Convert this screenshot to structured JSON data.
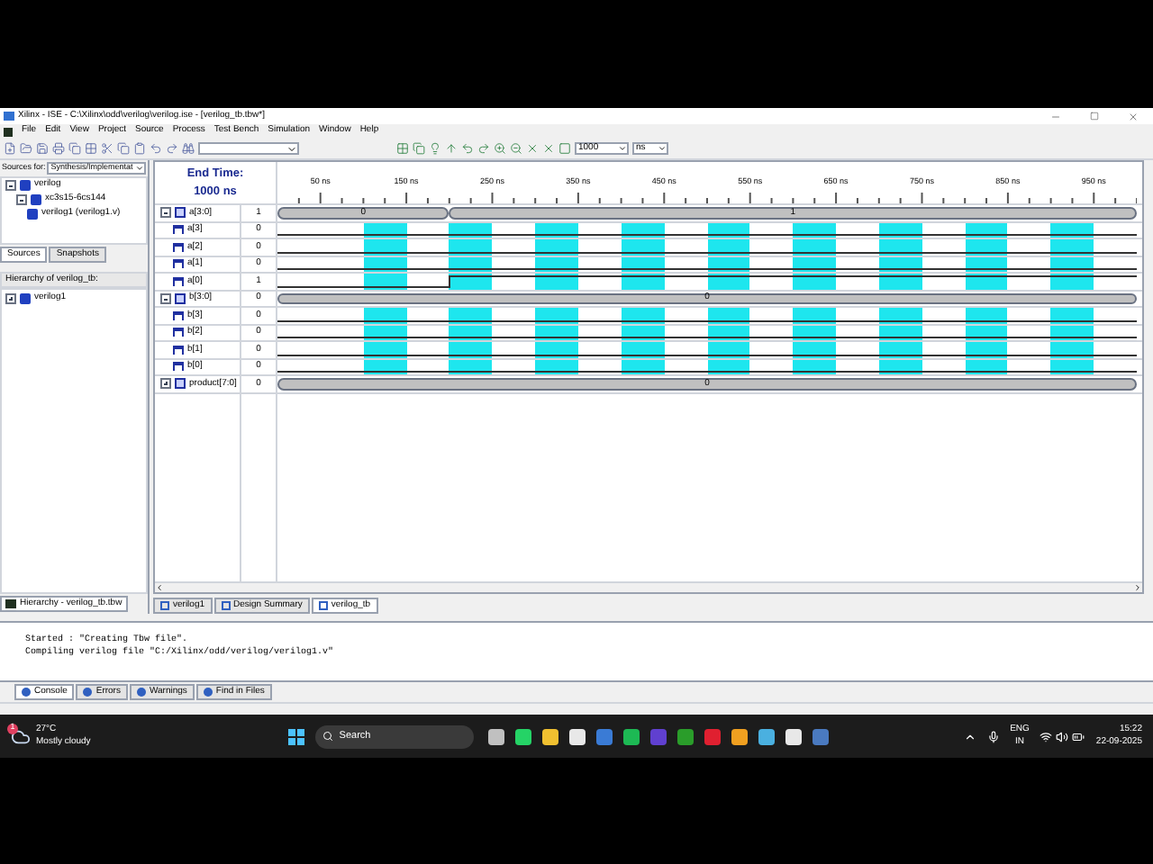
{
  "window": {
    "title": "Xilinx - ISE - C:\\Xilinx\\odd\\verilog\\verilog.ise - [verilog_tb.tbw*]"
  },
  "menu": [
    "File",
    "Edit",
    "View",
    "Project",
    "Source",
    "Process",
    "Test Bench",
    "Simulation",
    "Window",
    "Help"
  ],
  "toolbar": {
    "end_time": "1000",
    "unit": "ns"
  },
  "sources": {
    "label": "Sources for:",
    "mode": "Synthesis/Implementat",
    "tree": [
      {
        "label": "verilog",
        "expanded": true,
        "children": [
          {
            "label": "xc3s15-6cs144",
            "expanded": true,
            "children": [
              {
                "label": "verilog1 (verilog1.v)"
              }
            ]
          }
        ]
      }
    ],
    "tabs": [
      {
        "label": "Sources",
        "selected": true
      },
      {
        "label": "Snapshots",
        "selected": false
      }
    ]
  },
  "hierarchy": {
    "title": "Hierarchy of verilog_tb:",
    "tree": [
      {
        "label": "verilog1",
        "expanded": false
      }
    ],
    "tab": "Hierarchy - verilog_tb.tbw"
  },
  "waveform": {
    "end_time_label": "End Time:",
    "end_time": "1000 ns",
    "axis": [
      "50 ns",
      "150 ns",
      "250 ns",
      "350 ns",
      "450 ns",
      "550 ns",
      "650 ns",
      "750 ns",
      "850 ns",
      "950 ns"
    ],
    "signals": [
      {
        "name": "a[3:0]",
        "kind": "bus",
        "value": "1",
        "expanded": true,
        "segments": [
          {
            "value": "0",
            "level": 0.2
          },
          {
            "value": "1",
            "level": 0.8
          }
        ],
        "children": [
          {
            "name": "a[3]",
            "kind": "bit",
            "value": "0",
            "highlighted": true
          },
          {
            "name": "a[2]",
            "kind": "bit",
            "value": "0",
            "highlighted": true
          },
          {
            "name": "a[1]",
            "kind": "bit",
            "value": "0",
            "highlighted": true
          },
          {
            "name": "a[0]",
            "kind": "bit",
            "value": "1",
            "highlighted": true
          }
        ]
      },
      {
        "name": "b[3:0]",
        "kind": "bus",
        "value": "0",
        "expanded": true,
        "segments": [
          {
            "value": "0",
            "level": 1
          }
        ],
        "children": [
          {
            "name": "b[3]",
            "kind": "bit",
            "value": "0",
            "highlighted": true
          },
          {
            "name": "b[2]",
            "kind": "bit",
            "value": "0",
            "highlighted": true
          },
          {
            "name": "b[1]",
            "kind": "bit",
            "value": "0",
            "highlighted": true
          },
          {
            "name": "b[0]",
            "kind": "bit",
            "value": "0",
            "highlighted": true
          }
        ]
      },
      {
        "name": "product[7:0]",
        "kind": "bus",
        "value": "0",
        "expanded": false,
        "segments": [
          {
            "value": "0",
            "level": 1
          }
        ]
      }
    ]
  },
  "doc_tabs": [
    {
      "label": "verilog1",
      "selected": false
    },
    {
      "label": "Design Summary",
      "selected": false
    },
    {
      "label": "verilog_tb",
      "selected": true
    }
  ],
  "console": {
    "lines": [
      "Started : \"Creating Tbw file\".",
      "Compiling verilog file \"C:/Xilinx/odd/verilog/verilog1.v\""
    ],
    "tabs": [
      {
        "label": "Console",
        "selected": true
      },
      {
        "label": "Errors",
        "selected": false
      },
      {
        "label": "Warnings",
        "selected": false
      },
      {
        "label": "Find in Files",
        "selected": false
      }
    ]
  },
  "taskbar": {
    "weather": {
      "temp": "27°C",
      "condition": "Mostly cloudy",
      "badge": "1"
    },
    "search": "Search",
    "tray": {
      "language": "ENG",
      "region": "IN",
      "time": "15:22",
      "date": "22-09-2025"
    }
  }
}
